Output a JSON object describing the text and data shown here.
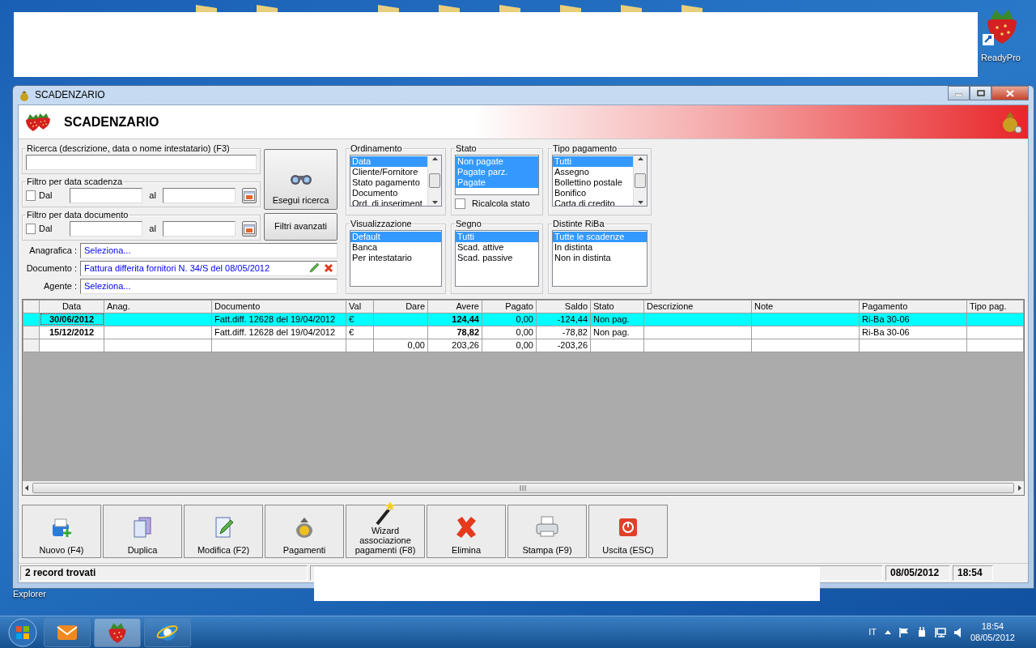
{
  "desktop": {
    "icons": [
      {
        "label": "ReadyPro",
        "kind": "strawberry"
      },
      {
        "label": "Explorer",
        "kind": "text"
      }
    ]
  },
  "window": {
    "title": "SCADENZARIO",
    "header": "SCADENZARIO"
  },
  "search": {
    "legend": "Ricerca (descrizione, data o nome intestatario) (F3)"
  },
  "date_filters": [
    {
      "legend": "Filtro per data scadenza",
      "checked": false,
      "from_label": "Dal",
      "to_label": "al"
    },
    {
      "legend": "Filtro per data documento",
      "checked": false,
      "from_label": "Dal",
      "to_label": "al"
    }
  ],
  "search_button": "Esegui ricerca",
  "advanced_button": "Filtri avanzati",
  "selectors": [
    {
      "label": "Anagrafica :",
      "value": "Seleziona...",
      "kind": "plain"
    },
    {
      "label": "Documento :",
      "value": "Fattura differita fornitori N. 34/S del 08/05/2012",
      "kind": "editable"
    },
    {
      "label": "Agente :",
      "value": "Seleziona...",
      "kind": "plain"
    }
  ],
  "lists": [
    {
      "legend": "Ordinamento",
      "scrollable": true,
      "items": [
        {
          "label": "Data",
          "selected": true
        },
        {
          "label": "Cliente/Fornitore",
          "selected": false
        },
        {
          "label": "Stato pagamento",
          "selected": false
        },
        {
          "label": "Documento",
          "selected": false
        },
        {
          "label": "Ord. di inseriment",
          "selected": false
        }
      ]
    },
    {
      "legend": "Stato",
      "scrollable": false,
      "items": [
        {
          "label": "Non pagate",
          "selected": true
        },
        {
          "label": "Pagate parz.",
          "selected": true
        },
        {
          "label": "Pagate",
          "selected": true
        }
      ],
      "checkbox": {
        "label": "Ricalcola stato",
        "checked": false
      }
    },
    {
      "legend": "Tipo pagamento",
      "scrollable": true,
      "items": [
        {
          "label": "Tutti",
          "selected": true
        },
        {
          "label": "Assegno",
          "selected": false
        },
        {
          "label": "Bollettino postale",
          "selected": false
        },
        {
          "label": "Bonifico",
          "selected": false
        },
        {
          "label": "Carta di credito",
          "selected": false
        }
      ]
    },
    {
      "legend": "Visualizzazione",
      "scrollable": false,
      "items": [
        {
          "label": "Default",
          "selected": true
        },
        {
          "label": "Banca",
          "selected": false
        },
        {
          "label": "Per intestatario",
          "selected": false
        }
      ]
    },
    {
      "legend": "Segno",
      "scrollable": false,
      "items": [
        {
          "label": "Tutti",
          "selected": true
        },
        {
          "label": "Scad. attive",
          "selected": false
        },
        {
          "label": "Scad. passive",
          "selected": false
        }
      ]
    },
    {
      "legend": "Distinte RiBa",
      "scrollable": false,
      "items": [
        {
          "label": "Tutte le scadenze",
          "selected": true
        },
        {
          "label": "In distinta",
          "selected": false
        },
        {
          "label": "Non in distinta",
          "selected": false
        }
      ]
    }
  ],
  "table": {
    "columns": [
      {
        "label": "Data",
        "kind": "date"
      },
      {
        "label": "Anag.",
        "kind": "text"
      },
      {
        "label": "Documento",
        "kind": "text"
      },
      {
        "label": "Val",
        "kind": "text"
      },
      {
        "label": "Dare",
        "kind": "amount"
      },
      {
        "label": "Avere",
        "kind": "key_amount"
      },
      {
        "label": "Pagato",
        "kind": "amount"
      },
      {
        "label": "Saldo",
        "kind": "amount"
      },
      {
        "label": "Stato",
        "kind": "text"
      },
      {
        "label": "Descrizione",
        "kind": "text"
      },
      {
        "label": "Note",
        "kind": "text"
      },
      {
        "label": "Pagamento",
        "kind": "text"
      },
      {
        "label": "Tipo pag.",
        "kind": "text"
      }
    ],
    "rows": [
      {
        "kind": "entry",
        "selected": true,
        "focused": true,
        "cells": [
          "30/06/2012",
          null,
          "Fatt.diff. 12628 del 19/04/2012",
          "€",
          null,
          "124,44",
          "0,00",
          "-124,44",
          "Non pag.",
          null,
          null,
          "Ri-Ba 30-06",
          null
        ]
      },
      {
        "kind": "entry",
        "selected": false,
        "focused": false,
        "cells": [
          "15/12/2012",
          null,
          "Fatt.diff. 12628 del 19/04/2012",
          "€",
          null,
          "78,82",
          "0,00",
          "-78,82",
          "Non pag.",
          null,
          null,
          "Ri-Ba 30-06",
          null
        ]
      },
      {
        "kind": "total",
        "selected": false,
        "focused": false,
        "cells": [
          null,
          null,
          null,
          null,
          "0,00",
          "203,26",
          "0,00",
          "-203,26",
          null,
          null,
          null,
          null,
          null
        ]
      }
    ]
  },
  "toolbar": [
    {
      "label": "Nuovo (F4)",
      "kind": "new"
    },
    {
      "label": "Duplica",
      "kind": "copy"
    },
    {
      "label": "Modifica (F2)",
      "kind": "edit"
    },
    {
      "label": "Pagamenti",
      "kind": "money"
    },
    {
      "label": "Wizard associazione pagamenti (F8)",
      "kind": "wizard"
    },
    {
      "label": "Elimina",
      "kind": "delete"
    },
    {
      "label": "Stampa (F9)",
      "kind": "print"
    },
    {
      "label": "Uscita (ESC)",
      "kind": "exit"
    }
  ],
  "status_bar": {
    "message": "2 record trovati",
    "date": "08/05/2012",
    "time": "18:54"
  },
  "taskbar": {
    "apps": [
      {
        "kind": "mail",
        "active": false
      },
      {
        "kind": "strawberry",
        "active": true
      },
      {
        "kind": "browser",
        "active": false
      }
    ],
    "language": "IT",
    "time": "18:54",
    "date": "08/05/2012"
  }
}
